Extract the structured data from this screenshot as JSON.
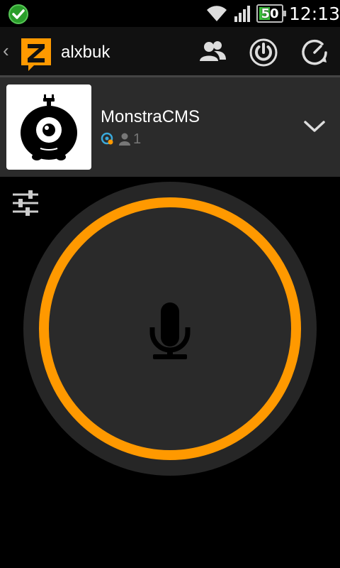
{
  "status_bar": {
    "time": "12:13",
    "battery_level": "50",
    "battery_fraction": 0.5
  },
  "action_bar": {
    "username": "alxbuk"
  },
  "channel": {
    "name": "MonstraCMS",
    "user_count": "1"
  },
  "colors": {
    "accent": "#ff9900",
    "panel": "#2b2b2b"
  },
  "icons": {
    "status": "check-circle-icon",
    "logo": "zello-logo",
    "contacts": "contacts-icon",
    "power": "power-icon",
    "status_menu": "status-icon",
    "settings": "sliders-icon",
    "mic": "microphone-icon"
  }
}
